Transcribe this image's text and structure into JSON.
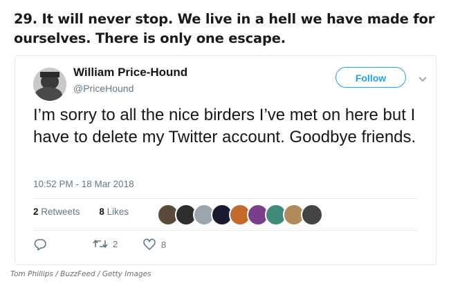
{
  "headline": "29. It will never stop. We live in a hell we have made for ourselves. There is only one escape.",
  "tweet": {
    "author_name": "William Price-Hound",
    "author_handle": "@PriceHound",
    "follow_label": "Follow",
    "text": "I’m sorry to all the nice birders I’ve met on here but I have to delete my Twitter account. Goodbye friends.",
    "timestamp": "10:52 PM - 18 Mar 2018",
    "stats": {
      "retweets_count": "2",
      "retweets_label": "Retweets",
      "likes_count": "8",
      "likes_label": "Likes"
    },
    "actions": {
      "retweet_count": "2",
      "like_count": "8"
    },
    "colors": {
      "accent": "#1da1f2",
      "secondary_text": "#657786",
      "border": "#e1e8ed"
    },
    "liker_avatars": [
      "#5a4a3a",
      "#2e2e2e",
      "#9aa5ae",
      "#1b1b2f",
      "#c46a2c",
      "#7a3f8c",
      "#3f8a7a",
      "#b08a5a",
      "#444444"
    ]
  },
  "credit": "Tom Phillips / BuzzFeed / Getty Images"
}
